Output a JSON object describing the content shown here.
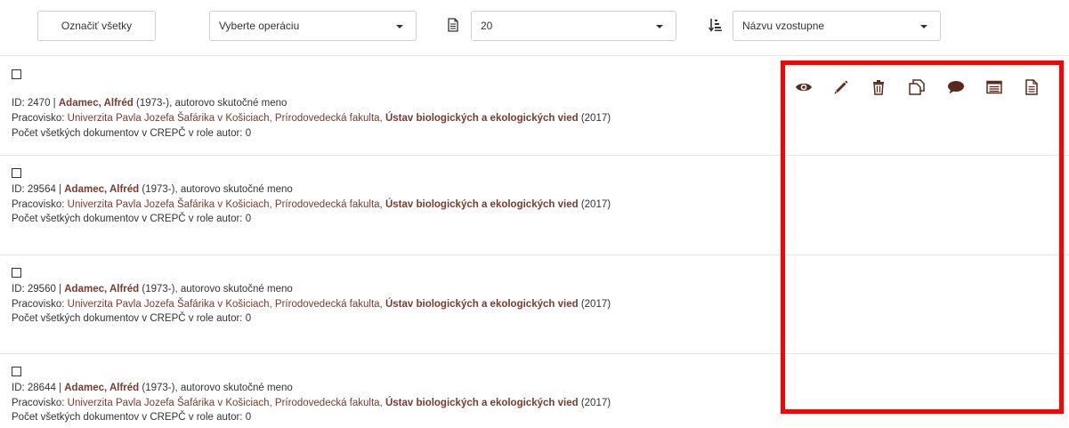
{
  "toolbar": {
    "select_all_label": "Označiť všetky",
    "operation_select": "Vyberte operáciu",
    "page_size_select": "20",
    "sort_select": "Názvu vzostupne"
  },
  "records": [
    {
      "id_prefix": "ID: 2470 | ",
      "name": "Adamec, Alfréd",
      "dates_note": " (1973-), autorovo skutočné meno",
      "workplace_label": "Pracovisko: ",
      "workplace_link": "Univerzita Pavla Jozefa Šafárika v Košiciach, Prírodovedecká fakulta, ",
      "workplace_bold": "Ústav biologických a ekologických vied",
      "workplace_year": " (2017)",
      "count_text": "Počet všetkých dokumentov v CREPČ v role autor: 0"
    },
    {
      "id_prefix": "ID: 29564 | ",
      "name": "Adamec, Alfréd",
      "dates_note": " (1973-),  autorovo skutočné meno",
      "workplace_label": "Pracovisko: ",
      "workplace_link": "Univerzita Pavla Jozefa Šafárika v Košiciach, Prírodovedecká fakulta, ",
      "workplace_bold": "Ústav biologických a ekologických vied",
      "workplace_year": " (2017)",
      "count_text": "Počet všetkých dokumentov v CREPČ v role autor: 0"
    },
    {
      "id_prefix": "ID: 29560 | ",
      "name": "Adamec, Alfréd",
      "dates_note": " (1973-),  autorovo skutočné meno",
      "workplace_label": "Pracovisko: ",
      "workplace_link": "Univerzita Pavla Jozefa Šafárika v Košiciach, Prírodovedecká fakulta, ",
      "workplace_bold": "Ústav biologických a ekologických vied",
      "workplace_year": " (2017)",
      "count_text": "Počet všetkých dokumentov v CREPČ v role autor: 0"
    },
    {
      "id_prefix": "ID: 28644 | ",
      "name": "Adamec, Alfréd",
      "dates_note": " (1973-),  autorovo skutočné meno",
      "workplace_label": "Pracovisko: ",
      "workplace_link": "Univerzita Pavla Jozefa Šafárika v Košiciach, Prírodovedecká fakulta, ",
      "workplace_bold": "Ústav biologických a ekologických vied",
      "workplace_year": " (2017)",
      "count_text": "Počet všetkých dokumentov v CREPČ v role autor: 0"
    }
  ],
  "actions": [
    "eye-icon",
    "pencil-icon",
    "trash-icon",
    "copy-icon",
    "comment-icon",
    "list-icon",
    "document-icon"
  ],
  "colors": {
    "link": "#7a3b2e",
    "highlight_border": "#ff0000",
    "icon": "#5a2a1e"
  }
}
